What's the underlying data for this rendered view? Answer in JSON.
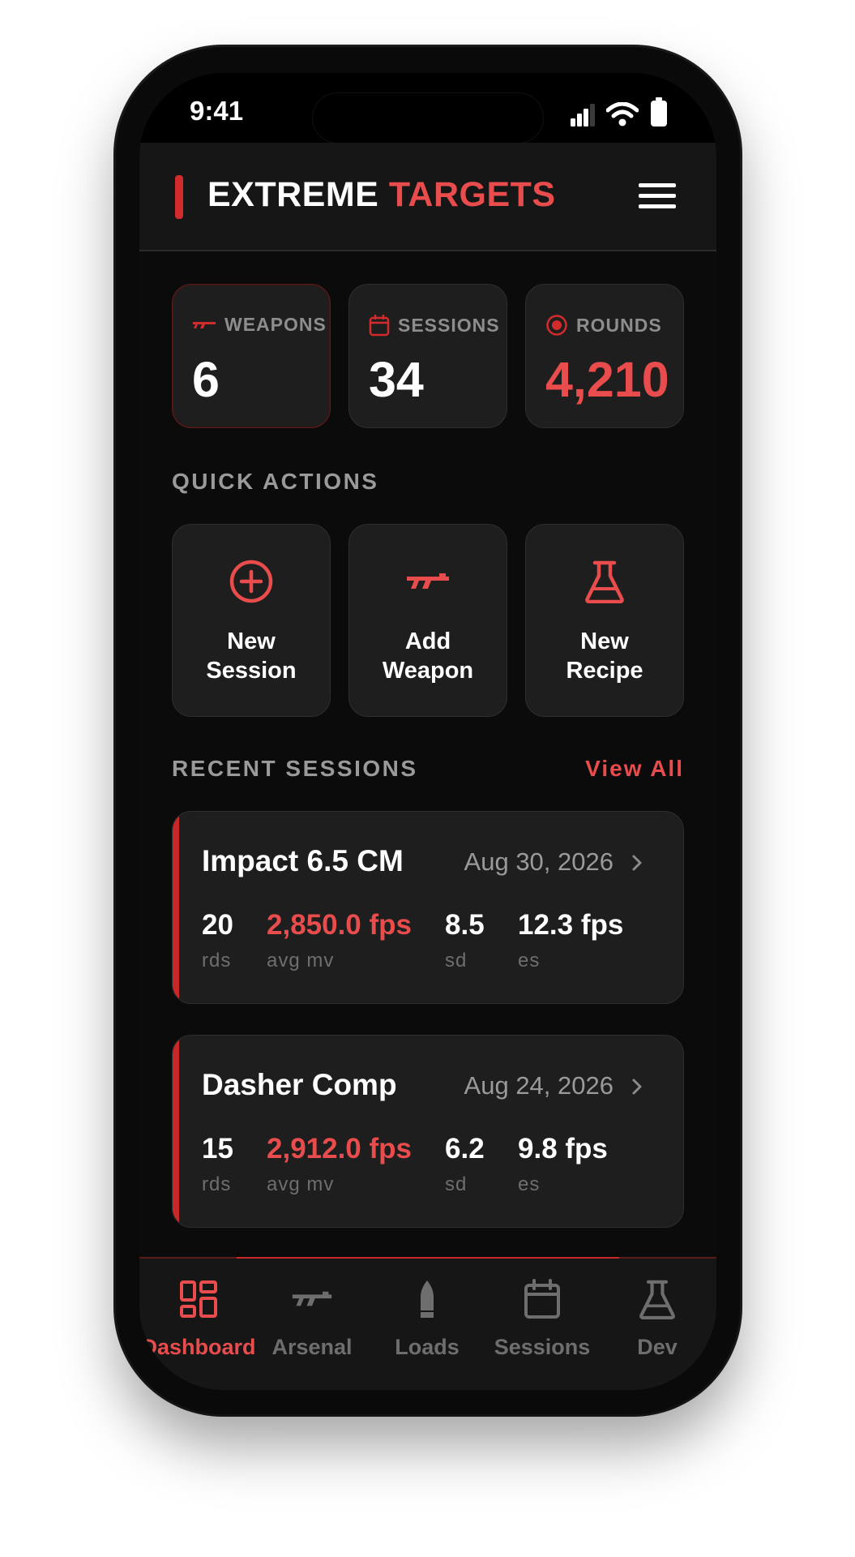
{
  "status_bar": {
    "time": "9:41"
  },
  "header": {
    "brand_primary": "EXTREME",
    "brand_accent": "TARGETS",
    "menu_icon": "hamburger-menu-icon"
  },
  "stats": [
    {
      "label": "WEAPONS",
      "value": "6",
      "icon": "rifle-icon"
    },
    {
      "label": "SESSIONS",
      "value": "34",
      "icon": "calendar-icon"
    },
    {
      "label": "ROUNDS",
      "value": "4,210",
      "icon": "target-icon"
    }
  ],
  "quick_actions": {
    "title": "QUICK ACTIONS",
    "items": [
      {
        "line1": "New",
        "line2": "Session",
        "icon": "plus-circle-icon"
      },
      {
        "line1": "Add",
        "line2": "Weapon",
        "icon": "rifle-icon"
      },
      {
        "line1": "New",
        "line2": "Recipe",
        "icon": "flask-icon"
      }
    ]
  },
  "recent_sessions": {
    "title": "RECENT SESSIONS",
    "view_all": "View All",
    "items": [
      {
        "name": "Impact 6.5 CM",
        "date": "Aug 30, 2026",
        "rounds": "20",
        "rounds_label": "rds",
        "avg_mv": "2,850.0 fps",
        "avg_mv_label": "avg mv",
        "sd": "8.5",
        "sd_label": "sd",
        "es": "12.3 fps",
        "es_label": "es"
      },
      {
        "name": "Dasher Comp",
        "date": "Aug 24, 2026",
        "rounds": "15",
        "rounds_label": "rds",
        "avg_mv": "2,912.0 fps",
        "avg_mv_label": "avg mv",
        "sd": "6.2",
        "sd_label": "sd",
        "es": "9.8 fps",
        "es_label": "es"
      }
    ]
  },
  "bottom_nav": [
    {
      "label": "Dashboard",
      "icon": "dashboard-icon",
      "active": true
    },
    {
      "label": "Arsenal",
      "icon": "rifle-icon",
      "active": false
    },
    {
      "label": "Loads",
      "icon": "bullet-icon",
      "active": false
    },
    {
      "label": "Sessions",
      "icon": "calendar-icon",
      "active": false
    },
    {
      "label": "Dev",
      "icon": "flask-icon",
      "active": false
    }
  ],
  "colors": {
    "accent": "#e84c4c",
    "accent_dark": "#c82828",
    "card": "#1e1e1e",
    "background": "#0b0b0b",
    "muted": "#6e6e6e"
  }
}
